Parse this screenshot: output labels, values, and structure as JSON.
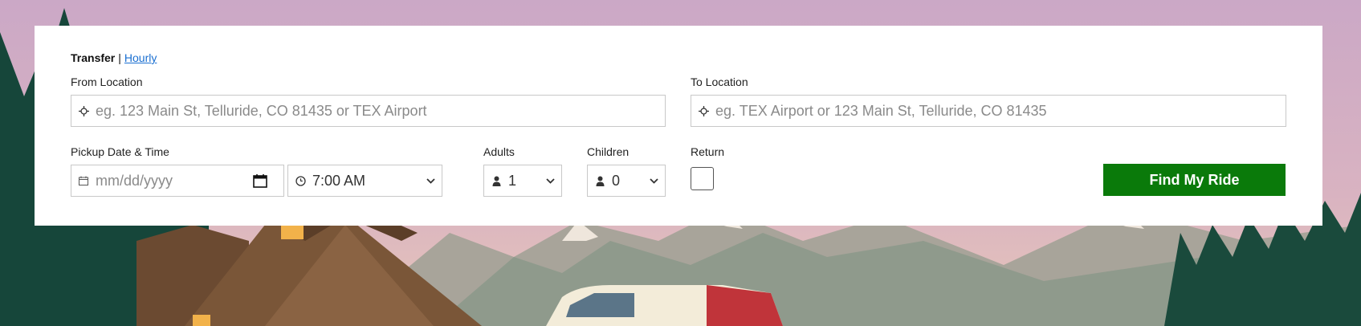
{
  "mode_switch": {
    "active_label": "Transfer",
    "separator": "|",
    "alt_label": "Hourly"
  },
  "from_location": {
    "label": "From Location",
    "placeholder": "eg. 123 Main St, Telluride, CO 81435 or TEX Airport",
    "icon": "crosshair-icon"
  },
  "to_location": {
    "label": "To Location",
    "placeholder": "eg. TEX Airport or 123 Main St, Telluride, CO 81435",
    "icon": "crosshair-icon"
  },
  "pickup": {
    "label": "Pickup Date & Time",
    "date_placeholder": "mm/dd/yyyy",
    "time_value": "7:00 AM",
    "date_icon": "calendar-icon",
    "time_icon": "clock-icon"
  },
  "adults": {
    "label": "Adults",
    "value": "1",
    "icon": "person-icon"
  },
  "children": {
    "label": "Children",
    "value": "0",
    "icon": "person-icon"
  },
  "return": {
    "label": "Return",
    "checked": false
  },
  "submit": {
    "label": "Find My Ride"
  },
  "colors": {
    "button_bg": "#0a7a0a",
    "link": "#1a6fd1",
    "sky": "#c9a8c4"
  }
}
